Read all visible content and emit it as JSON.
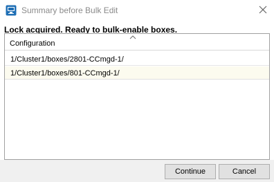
{
  "window": {
    "title": "Summary before Bulk Edit",
    "app_icon": "network-boxes-icon",
    "close_icon": "close-icon"
  },
  "status_message": "Lock acquired. Ready to bulk-enable boxes.",
  "table": {
    "columns": [
      "Configuration"
    ],
    "sort_indicator": "sort-ascending-icon",
    "rows": [
      {
        "configuration": "1/Cluster1/boxes/2801-CCmgd-1/"
      },
      {
        "configuration": "1/Cluster1/boxes/801-CCmgd-1/"
      }
    ]
  },
  "buttons": {
    "continue_label": "Continue",
    "cancel_label": "Cancel"
  },
  "colors": {
    "app_icon_blue": "#1f6fb5",
    "row_alt": "#fcfbef"
  }
}
